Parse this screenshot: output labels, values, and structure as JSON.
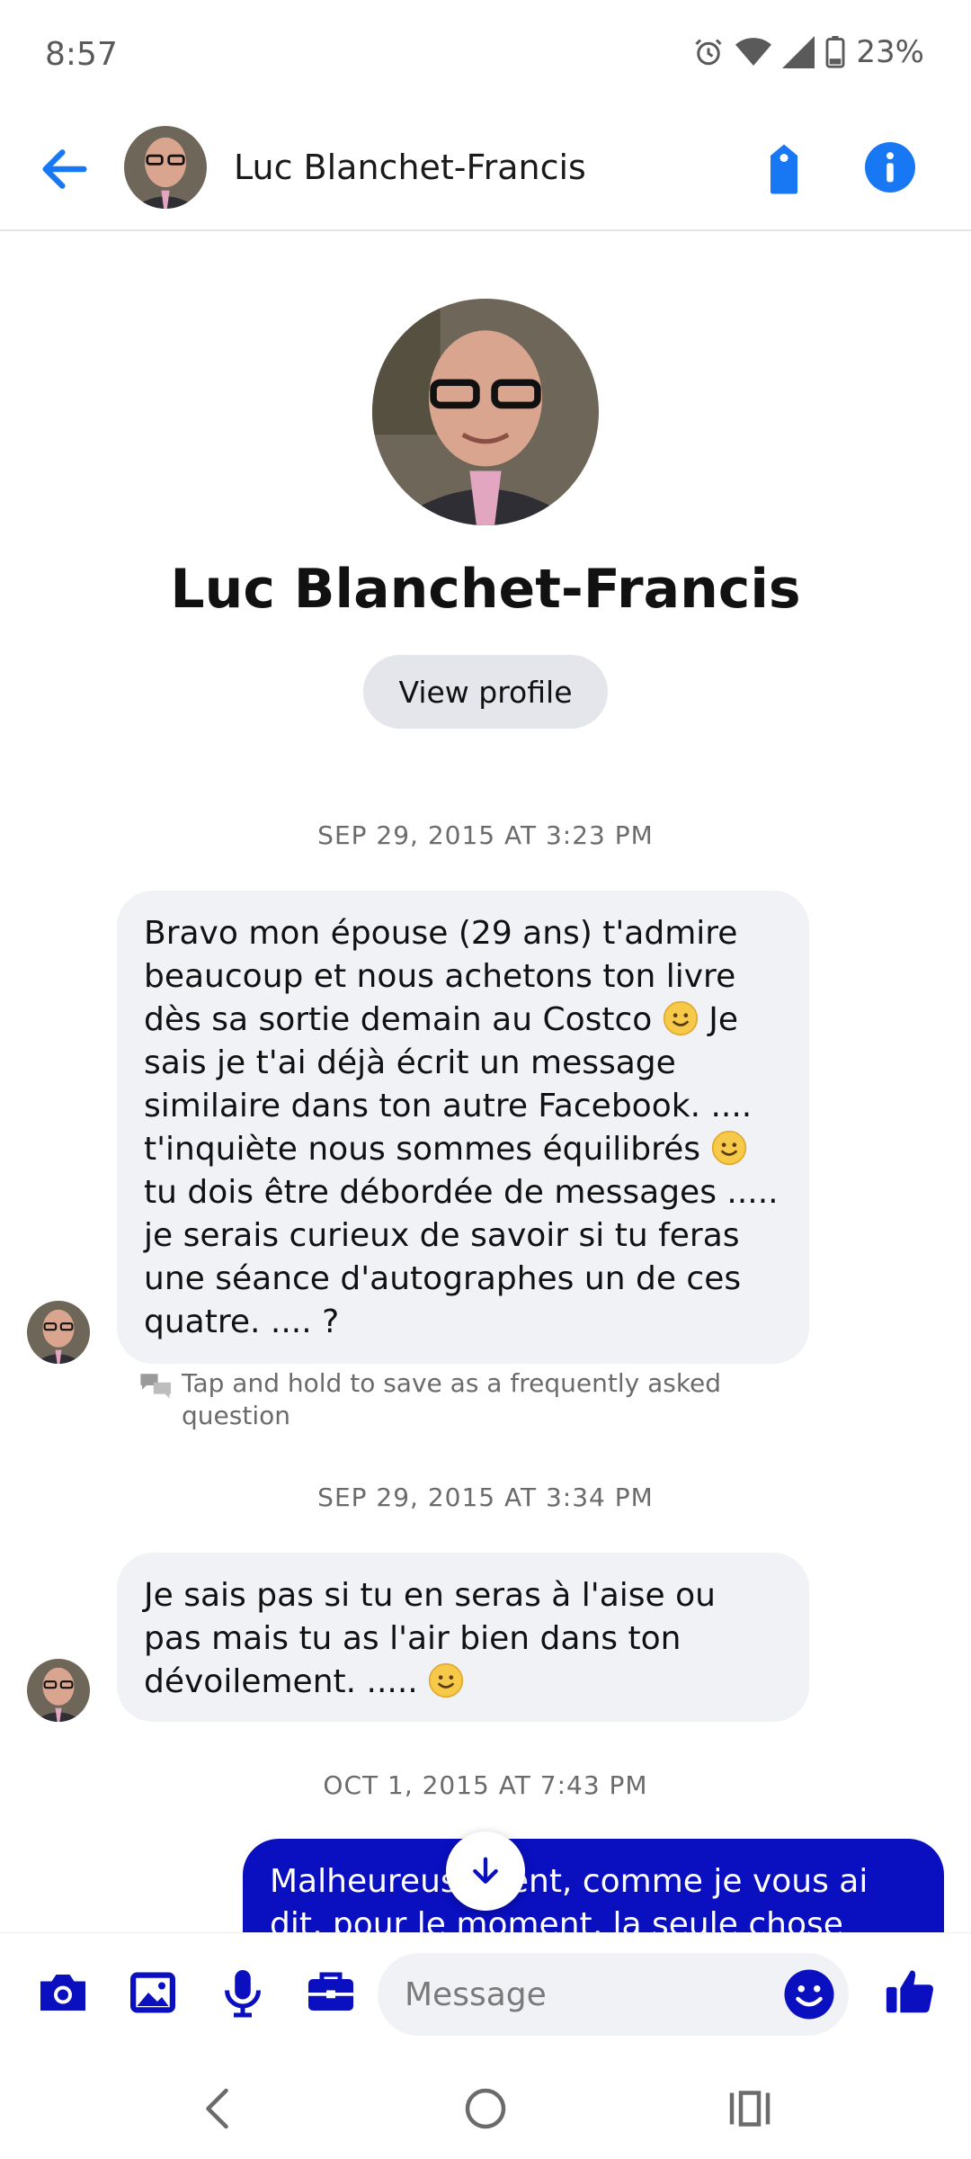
{
  "status_bar": {
    "time": "8:57",
    "battery": "23%",
    "icons": [
      "alarm-icon",
      "wifi-icon",
      "signal-icon",
      "battery-icon"
    ]
  },
  "header": {
    "contact_name": "Luc Blanchet-Francis",
    "icons": [
      "back-arrow-icon",
      "tag-icon",
      "info-icon"
    ],
    "accent_color": "#1877f2"
  },
  "profile": {
    "name": "Luc Blanchet-Francis",
    "view_profile_label": "View profile"
  },
  "conversation": {
    "timestamps": [
      "SEP 29, 2015 AT 3:23 PM",
      "SEP 29, 2015 AT 3:34 PM",
      "OCT 1, 2015 AT 7:43 PM"
    ],
    "messages": [
      {
        "direction": "incoming",
        "parts": [
          "Bravo mon épouse (29 ans) t'admire beaucoup et nous achetons ton livre dès sa sortie demain au Costco",
          " Je sais je t'ai déjà écrit un message similaire dans ton autre Facebook. .... t'inquiète nous sommes équilibrés",
          " tu dois être débordée de messages ..... je serais curieux de savoir si tu feras une séance d'autographes un de ces quatre. .... ?"
        ]
      },
      {
        "direction": "incoming",
        "parts": [
          "Je sais pas si tu en seras à l'aise ou pas mais tu as l'air bien dans ton dévoilement. ....."
        ]
      },
      {
        "direction": "outgoing",
        "text": "Malheureusement, comme je vous ai dit, pour le moment, la seule chose",
        "color": "#0a0fbf"
      }
    ],
    "faq_hint": "Tap and hold to save as a frequently asked question"
  },
  "composer": {
    "placeholder": "Message",
    "icons": [
      "camera-icon",
      "gallery-icon",
      "microphone-icon",
      "briefcase-icon",
      "emoji-icon",
      "thumbs-up-icon"
    ],
    "icon_color": "#0a0fbf"
  },
  "navbar": {
    "icons": [
      "back-nav-icon",
      "home-nav-icon",
      "recents-nav-icon"
    ]
  }
}
